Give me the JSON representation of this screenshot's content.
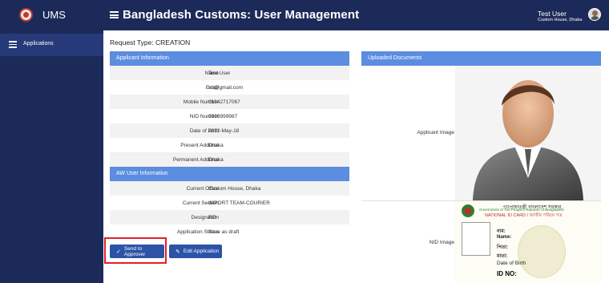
{
  "app": {
    "short_name": "UMS",
    "title": "Bangladesh Customs: User Management"
  },
  "user": {
    "name": "Test User",
    "location": "Custom House, Dhaka"
  },
  "sidebar": {
    "items": [
      {
        "label": "Applications",
        "icon": "list-icon"
      }
    ]
  },
  "request": {
    "label": "Request Type: CREATION"
  },
  "applicant": {
    "header": "Applicant Information",
    "rows": [
      {
        "label": "Name",
        "value": "Test User"
      },
      {
        "label": "Email",
        "value": "sd@gmail.com"
      },
      {
        "label": "Mobile Number",
        "value": "01942717067"
      },
      {
        "label": "NID Number",
        "value": "9999999987"
      },
      {
        "label": "Date of Birth",
        "value": "2022-May-18"
      },
      {
        "label": "Present Address",
        "value": "Dhaka"
      },
      {
        "label": "Permanent Address",
        "value": "Dhaka"
      }
    ]
  },
  "aw_user": {
    "header": "AW User Information",
    "rows": [
      {
        "label": "Current Office",
        "value": "Custom House, Dhaka"
      },
      {
        "label": "Current Section",
        "value": "IMPORT TEAM-COURIER"
      },
      {
        "label": "Designation",
        "value": "RO"
      },
      {
        "label": "Application Status",
        "value": "Save as draft"
      }
    ]
  },
  "actions": {
    "send_label": "Send to Approver",
    "edit_label": "Edit Application"
  },
  "documents": {
    "header": "Uploaded Documents",
    "applicant_image_label": "Applicant Image",
    "nid_image_label": "NID Image",
    "nid_card": {
      "title_bn": "গণপ্রজাতন্ত্রী বাংলাদেশ সরকার",
      "title_en": "Government of The People's Republic of Bangladesh",
      "card_label": "NATIONAL ID CARD / জাতীয় পরিচয় পত্র",
      "fields": [
        "নাম:",
        "Name:",
        "পিতা:",
        "মাতা:",
        "Date of Birth",
        "ID NO:"
      ]
    }
  },
  "colors": {
    "navy": "#1c2a5a",
    "panel_header": "#5b8de0",
    "button": "#2c53a8",
    "highlight": "#e0212a"
  }
}
